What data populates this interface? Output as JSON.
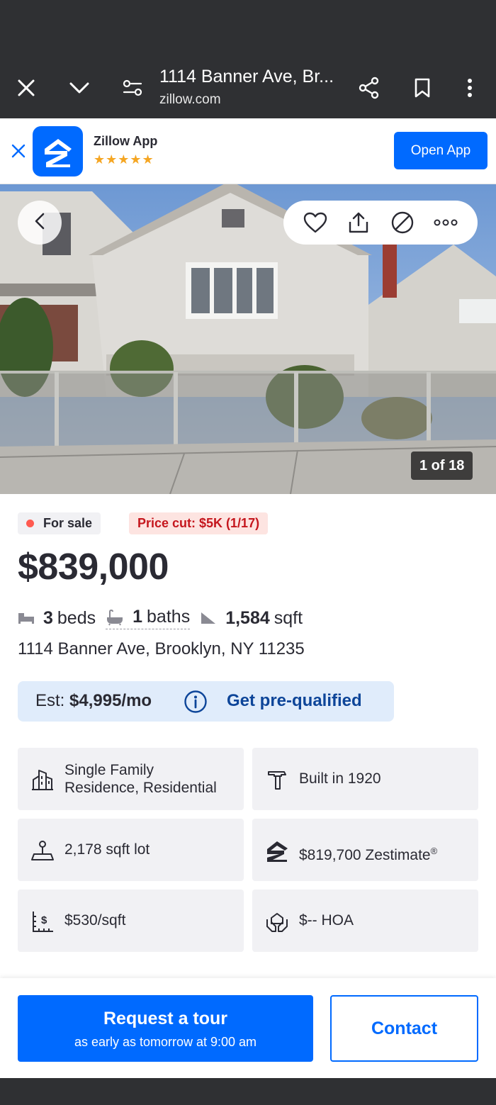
{
  "browser": {
    "title": "1114 Banner Ave, Br...",
    "url": "zillow.com",
    "icons": [
      "close-icon",
      "chevron-down-icon",
      "site-settings-icon",
      "share-icon",
      "bookmark-icon",
      "more-vert-icon"
    ]
  },
  "app_banner": {
    "name": "Zillow App",
    "stars": "★★★★★",
    "open_label": "Open App"
  },
  "photo": {
    "counter": "1 of 18",
    "icons": [
      "back-icon",
      "heart-icon",
      "share-icon",
      "hide-icon",
      "more-icon"
    ]
  },
  "listing": {
    "status": "For sale",
    "price_cut": "Price cut: $5K (1/17)",
    "price": "$839,000",
    "beds_num": "3",
    "beds_label": "beds",
    "baths_num": "1",
    "baths_label": "baths",
    "sqft_num": "1,584",
    "sqft_label": "sqft",
    "address": "1114 Banner Ave, Brooklyn, NY 11235",
    "est_prefix": "Est:",
    "est_value": "$4,995/mo",
    "prequal": "Get pre-qualified"
  },
  "facts": {
    "type_line1": "Single Family",
    "type_line2": "Residence, Residential",
    "built": "Built in 1920",
    "lot": "2,178 sqft lot",
    "zestimate": "$819,700 Zestimate",
    "zestimate_mark": "®",
    "price_per_sqft": "$530/sqft",
    "hoa": "$-- HOA"
  },
  "cta": {
    "tour_main": "Request a tour",
    "tour_sub": "as early as tomorrow at 9:00 am",
    "contact": "Contact"
  },
  "colors": {
    "brand_blue": "#006aff",
    "dark_chrome": "#2f3033",
    "sale_dot": "#ff5a50",
    "price_cut_text": "#c5161d",
    "est_bg": "#e0ecfb",
    "tile_bg": "#f1f1f4"
  }
}
